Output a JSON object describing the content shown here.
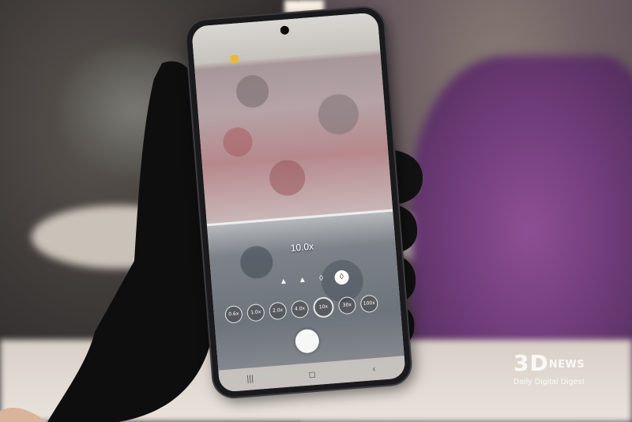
{
  "camera": {
    "zoom_value": "10.0x",
    "scene_icons": [
      "mountain-icon",
      "mountain-icon",
      "drop-icon",
      "drop-icon"
    ],
    "zoom_levels": [
      "0.6x",
      "1.0x",
      "2.0x",
      "4.0x",
      "10x",
      "30x",
      "100x"
    ],
    "active_zoom": "10x"
  },
  "nav": {
    "recents": "|||",
    "home": "◻",
    "back": "‹"
  },
  "watermark": {
    "logo_main": "3D",
    "logo_suffix": "NEWS",
    "tagline": "Daily Digital Digest"
  },
  "colors": {
    "glove": "#111111",
    "blanket": "#7a4584",
    "badge": "#e9b93b"
  }
}
